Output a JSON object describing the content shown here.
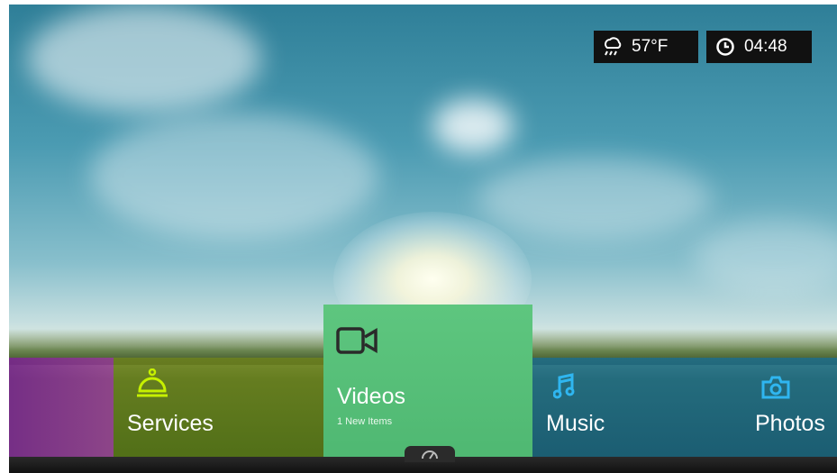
{
  "status": {
    "weather": {
      "icon": "weather-rain-cloud-icon",
      "temperature": "57°F"
    },
    "clock": {
      "icon": "clock-icon",
      "time": "04:48"
    }
  },
  "menu": {
    "tiles": [
      {
        "id": "prev",
        "label": "",
        "color": "#8a3a96"
      },
      {
        "id": "services",
        "label": "Services",
        "icon": "service-bell-icon",
        "icon_color": "#c6f000",
        "color": "#6e8a1e"
      },
      {
        "id": "videos",
        "label": "Videos",
        "sub": "1 New Items",
        "icon": "video-camera-icon",
        "color": "#59c07a",
        "selected": true
      },
      {
        "id": "music",
        "label": "Music",
        "icon": "music-note-icon",
        "icon_color": "#2fb6f0",
        "color": "#1f6f8c"
      },
      {
        "id": "photos",
        "label": "Photos",
        "icon": "camera-icon",
        "icon_color": "#2fb6f0",
        "color": "#1f6f8c"
      }
    ]
  },
  "bottom": {
    "tab_icon": "gauge-icon"
  }
}
